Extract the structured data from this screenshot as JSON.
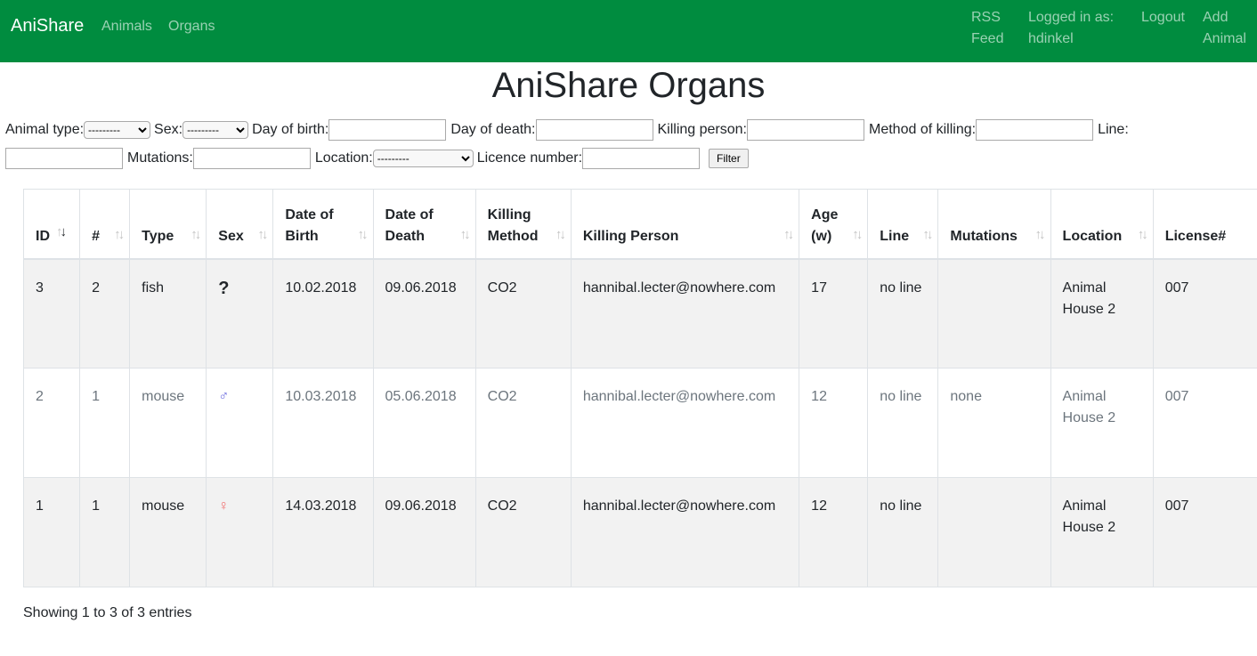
{
  "nav": {
    "brand": "AniShare",
    "links": [
      "Animals",
      "Organs"
    ],
    "rss_line1": "RSS",
    "rss_line2": "Feed",
    "logged_line1": "Logged in as:",
    "logged_line2": "hdinkel",
    "logout": "Logout",
    "add_line1": "Add",
    "add_line2": "Animal"
  },
  "page_title": "AniShare Organs",
  "filters": {
    "animal_type_label": "Animal type:",
    "sex_label": "Sex:",
    "day_of_birth_label": "Day of birth:",
    "day_of_death_label": "Day of death:",
    "killing_person_label": "Killing person:",
    "method_of_killing_label": "Method of killing:",
    "line_label": "Line:",
    "mutations_label": "Mutations:",
    "location_label": "Location:",
    "licence_number_label": "Licence number:",
    "select_default": "---------",
    "filter_button": "Filter"
  },
  "table": {
    "headers": [
      {
        "l1": "ID",
        "l2": ""
      },
      {
        "l1": "#",
        "l2": ""
      },
      {
        "l1": "Type",
        "l2": ""
      },
      {
        "l1": "Sex",
        "l2": ""
      },
      {
        "l1": "Date of",
        "l2": "Birth"
      },
      {
        "l1": "Date of",
        "l2": "Death"
      },
      {
        "l1": "Killing",
        "l2": "Method"
      },
      {
        "l1": "Killing Person",
        "l2": ""
      },
      {
        "l1": "Age",
        "l2": "(w)"
      },
      {
        "l1": "Line",
        "l2": ""
      },
      {
        "l1": "Mutations",
        "l2": ""
      },
      {
        "l1": "Location",
        "l2": ""
      },
      {
        "l1": "License#",
        "l2": ""
      }
    ],
    "rows": [
      {
        "id": "3",
        "num": "2",
        "type": "fish",
        "sex": "?",
        "dob": "10.02.2018",
        "dod": "09.06.2018",
        "method": "CO2",
        "person": "hannibal.lecter@nowhere.com",
        "age": "17",
        "line": "no line",
        "mutations": "",
        "loc1": "Animal",
        "loc2": "House 2",
        "license": "007"
      },
      {
        "id": "2",
        "num": "1",
        "type": "mouse",
        "sex": "♂",
        "dob": "10.03.2018",
        "dod": "05.06.2018",
        "method": "CO2",
        "person": "hannibal.lecter@nowhere.com",
        "age": "12",
        "line": "no line",
        "mutations": "none",
        "loc1": "Animal",
        "loc2": "House 2",
        "license": "007"
      },
      {
        "id": "1",
        "num": "1",
        "type": "mouse",
        "sex": "♀",
        "dob": "14.03.2018",
        "dod": "09.06.2018",
        "method": "CO2",
        "person": "hannibal.lecter@nowhere.com",
        "age": "12",
        "line": "no line",
        "mutations": "",
        "loc1": "Animal",
        "loc2": "House 2",
        "license": "007"
      }
    ]
  },
  "info": "Showing 1 to 3 of 3 entries",
  "colors": {
    "navbar": "#008c3f",
    "male": "#6a6adf",
    "female": "#f07070"
  }
}
